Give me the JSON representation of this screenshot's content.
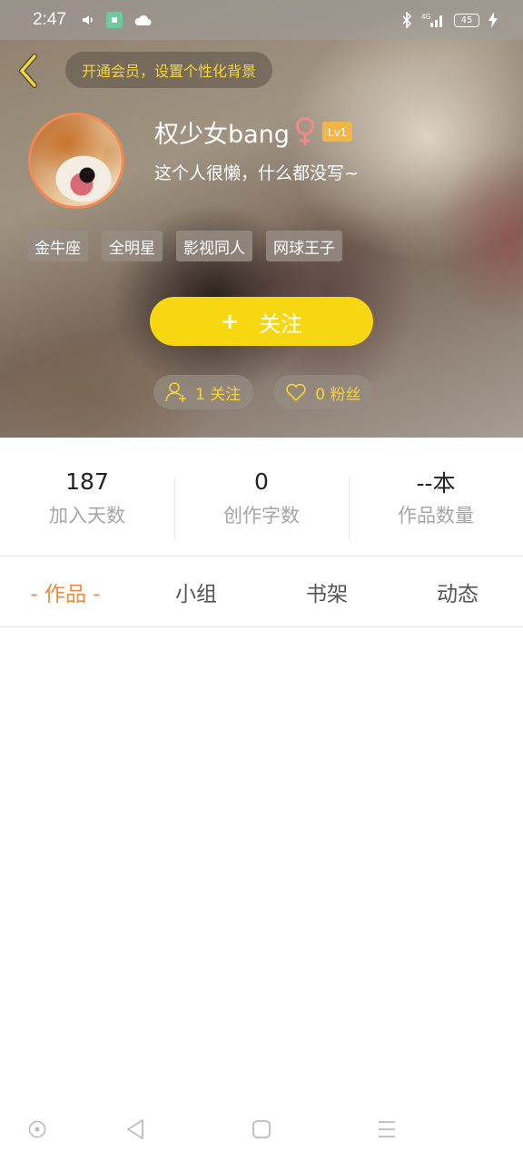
{
  "status_bar": {
    "time": "2:47",
    "battery": "45",
    "network": "4G",
    "icons": [
      "volume-icon",
      "app-icon",
      "cloud-icon",
      "bluetooth-icon",
      "signal-icon",
      "battery-icon",
      "charging-icon"
    ]
  },
  "header": {
    "vip_banner": "开通会员，设置个性化背景",
    "username": "权少女bang",
    "gender": "♀",
    "level": "Lv1",
    "bio": "这个人很懒，什么都没写~",
    "tags": [
      "金牛座",
      "全明星",
      "影视同人",
      "网球王子"
    ],
    "follow_button": {
      "icon": "+",
      "label": "关注"
    },
    "following": "1 关注",
    "fans": "0 粉丝"
  },
  "stats": [
    {
      "value": "187",
      "label": "加入天数"
    },
    {
      "value": "0",
      "label": "创作字数"
    },
    {
      "value": "--本",
      "label": "作品数量"
    }
  ],
  "tabs": [
    {
      "label": "- 作品 -",
      "active": true
    },
    {
      "label": "小组",
      "active": false
    },
    {
      "label": "书架",
      "active": false
    },
    {
      "label": "动态",
      "active": false
    }
  ],
  "colors": {
    "accent_yellow": "#f7d711",
    "active_tab": "#f0893c",
    "level_badge": "#f2b548",
    "gender": "#f08a8a"
  }
}
